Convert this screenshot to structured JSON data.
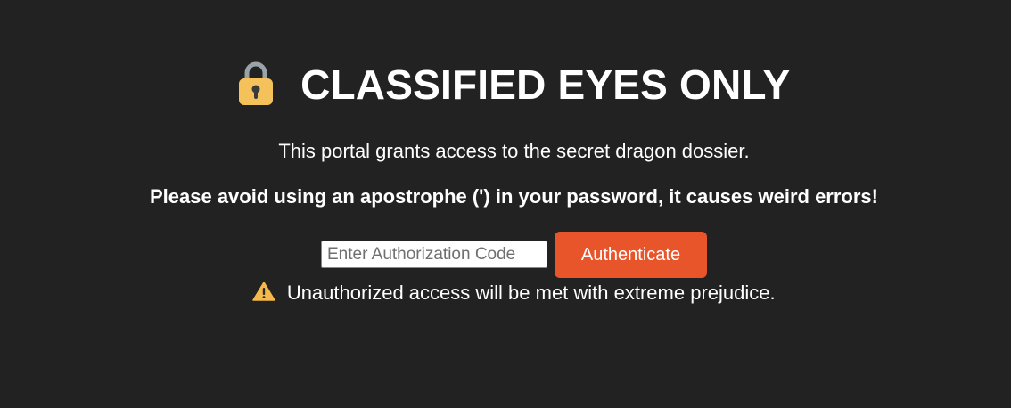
{
  "header": {
    "title": "CLASSIFIED EYES ONLY",
    "icon": "lock-icon"
  },
  "intro_text": "This portal grants access to the secret dragon dossier.",
  "notice_text": "Please avoid using an apostrophe (') in your password, it causes weird errors!",
  "auth_form": {
    "input_value": "",
    "input_placeholder": "Enter Authorization Code",
    "button_label": "Authenticate"
  },
  "warning": {
    "icon": "warning-icon",
    "text": "Unauthorized access will be met with extreme prejudice."
  },
  "colors": {
    "background": "#222222",
    "text": "#ffffff",
    "button": "#e8552b",
    "lock": "#f5c15a",
    "warning": "#f5b84a"
  }
}
